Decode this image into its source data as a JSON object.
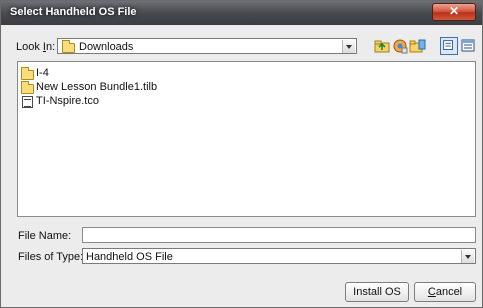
{
  "window": {
    "title": "Select Handheld OS File",
    "close_glyph": "✕"
  },
  "look_in": {
    "label_prefix": "Look ",
    "label_mnemonic": "I",
    "label_suffix": "n:",
    "value": "Downloads",
    "folder_icon": "folder-icon"
  },
  "toolbar": {
    "icons": [
      "up-one-level-icon",
      "desktop-icon",
      "create-new-folder-icon",
      "list-view-icon",
      "details-view-icon"
    ]
  },
  "files": [
    {
      "name": "I-4",
      "icon": "folder-icon"
    },
    {
      "name": "New Lesson Bundle1.tilb",
      "icon": "folder-icon"
    },
    {
      "name": "TI-Nspire.tco",
      "icon": "file-icon"
    }
  ],
  "file_name": {
    "label": "File Name:",
    "value": ""
  },
  "file_type": {
    "label": "Files of Type:",
    "value": "Handheld OS File"
  },
  "buttons": {
    "install": "Install OS",
    "cancel_mnemonic": "C",
    "cancel_rest": "ancel"
  }
}
